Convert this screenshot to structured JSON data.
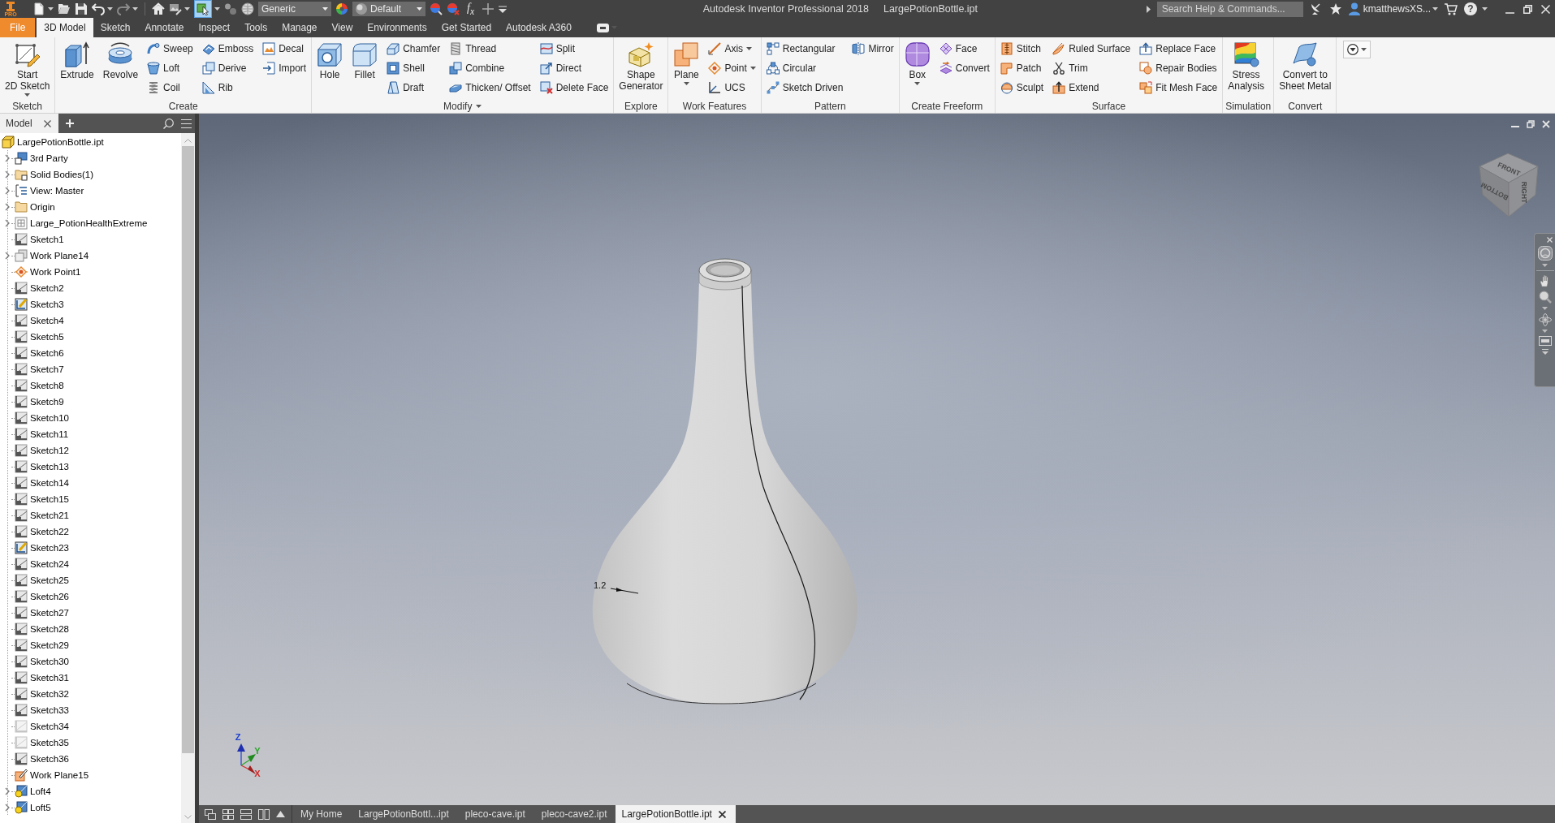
{
  "title_bar": {
    "badge": "PRO",
    "app_title": "Autodesk Inventor Professional 2018",
    "document": "LargePotionBottle.ipt",
    "search": {
      "placeholder": "Search Help & Commands..."
    },
    "user": "kmatthewsXS...",
    "help": "?"
  },
  "quick_access": {
    "material": "Generic",
    "appearance": "Default",
    "formula": "f$_{x}$"
  },
  "ribbon_tabs": [
    {
      "label": "File",
      "kind": "menu",
      "selected": false
    },
    {
      "label": "3D Model",
      "kind": "tab",
      "selected": true
    },
    {
      "label": "Sketch",
      "kind": "tab",
      "selected": false
    },
    {
      "label": "Annotate",
      "kind": "tab",
      "selected": false
    },
    {
      "label": "Inspect",
      "kind": "tab",
      "selected": false
    },
    {
      "label": "Tools",
      "kind": "tab",
      "selected": false
    },
    {
      "label": "Manage",
      "kind": "tab",
      "selected": false
    },
    {
      "label": "View",
      "kind": "tab",
      "selected": false
    },
    {
      "label": "Environments",
      "kind": "tab",
      "selected": false
    },
    {
      "label": "Get Started",
      "kind": "tab",
      "selected": false
    },
    {
      "label": "Autodesk A360",
      "kind": "tab",
      "selected": false
    }
  ],
  "ribbon_panels": [
    {
      "title": "Sketch",
      "menu": false,
      "buttons": [
        {
          "label": "Start\n2D Sketch",
          "kind": "large",
          "dropdown": true
        }
      ]
    },
    {
      "title": "Create",
      "menu": false,
      "buttons": [
        {
          "label": "Extrude",
          "kind": "large",
          "dropdown": false
        },
        {
          "label": "Revolve",
          "kind": "large",
          "dropdown": false
        },
        {
          "label": "Sweep",
          "kind": "small",
          "dropdown": false
        },
        {
          "label": "Loft",
          "kind": "small",
          "dropdown": false
        },
        {
          "label": "Coil",
          "kind": "small",
          "dropdown": false
        },
        {
          "label": "Emboss",
          "kind": "small",
          "dropdown": false
        },
        {
          "label": "Derive",
          "kind": "small",
          "dropdown": false
        },
        {
          "label": "Rib",
          "kind": "small",
          "dropdown": false
        },
        {
          "label": "Decal",
          "kind": "small",
          "dropdown": false
        },
        {
          "label": "Import",
          "kind": "small",
          "dropdown": false
        }
      ]
    },
    {
      "title": "Modify",
      "menu": true,
      "buttons": [
        {
          "label": "Hole",
          "kind": "large",
          "dropdown": false
        },
        {
          "label": "Fillet",
          "kind": "large",
          "dropdown": false
        },
        {
          "label": "Chamfer",
          "kind": "small",
          "dropdown": false
        },
        {
          "label": "Shell",
          "kind": "small",
          "dropdown": false
        },
        {
          "label": "Draft",
          "kind": "small",
          "dropdown": false
        },
        {
          "label": "Thread",
          "kind": "small",
          "dropdown": false
        },
        {
          "label": "Combine",
          "kind": "small",
          "dropdown": false
        },
        {
          "label": "Thicken/ Offset",
          "kind": "small",
          "dropdown": false
        },
        {
          "label": "Split",
          "kind": "small",
          "dropdown": false
        },
        {
          "label": "Direct",
          "kind": "small",
          "dropdown": false
        },
        {
          "label": "Delete Face",
          "kind": "small",
          "dropdown": false
        }
      ]
    },
    {
      "title": "Explore",
      "menu": false,
      "buttons": [
        {
          "label": "Shape\nGenerator",
          "kind": "large",
          "dropdown": false
        }
      ]
    },
    {
      "title": "Work Features",
      "menu": false,
      "buttons": [
        {
          "label": "Plane",
          "kind": "large",
          "dropdown": true
        },
        {
          "label": "Axis",
          "kind": "small",
          "dropdown": true
        },
        {
          "label": "Point",
          "kind": "small",
          "dropdown": true
        },
        {
          "label": "UCS",
          "kind": "small",
          "dropdown": false
        }
      ]
    },
    {
      "title": "Pattern",
      "menu": false,
      "buttons": [
        {
          "label": "Rectangular",
          "kind": "small",
          "dropdown": false
        },
        {
          "label": "Circular",
          "kind": "small",
          "dropdown": false
        },
        {
          "label": "Sketch Driven",
          "kind": "small",
          "dropdown": false
        },
        {
          "label": "Mirror",
          "kind": "small",
          "dropdown": false
        }
      ]
    },
    {
      "title": "Create Freeform",
      "menu": false,
      "buttons": [
        {
          "label": "Box",
          "kind": "large",
          "dropdown": true
        },
        {
          "label": "Face",
          "kind": "small",
          "dropdown": false
        },
        {
          "label": "Convert",
          "kind": "small",
          "dropdown": false
        }
      ]
    },
    {
      "title": "Surface",
      "menu": false,
      "buttons": [
        {
          "label": "Stitch",
          "kind": "small",
          "dropdown": false
        },
        {
          "label": "Patch",
          "kind": "small",
          "dropdown": false
        },
        {
          "label": "Sculpt",
          "kind": "small",
          "dropdown": false
        },
        {
          "label": "Ruled Surface",
          "kind": "small",
          "dropdown": false
        },
        {
          "label": "Trim",
          "kind": "small",
          "dropdown": false
        },
        {
          "label": "Extend",
          "kind": "small",
          "dropdown": false
        },
        {
          "label": "Replace Face",
          "kind": "small",
          "dropdown": false
        },
        {
          "label": "Repair Bodies",
          "kind": "small",
          "dropdown": false
        },
        {
          "label": "Fit Mesh Face",
          "kind": "small",
          "dropdown": false
        }
      ]
    },
    {
      "title": "Simulation",
      "menu": false,
      "buttons": [
        {
          "label": "Stress\nAnalysis",
          "kind": "large",
          "dropdown": false
        }
      ]
    },
    {
      "title": "Convert",
      "menu": false,
      "buttons": [
        {
          "label": "Convert to\nSheet Metal",
          "kind": "large",
          "dropdown": false
        }
      ]
    }
  ],
  "model_browser": {
    "tab": "Model",
    "tree": [
      {
        "label": "LargePotionBottle.ipt",
        "kind": "part",
        "collapsed": false,
        "children": [
          {
            "label": "3rd Party",
            "kind": "thirdparty",
            "collapsed": true
          },
          {
            "label": "Solid Bodies(1)",
            "kind": "bodies",
            "collapsed": true
          },
          {
            "label": "View: Master",
            "kind": "view",
            "collapsed": true
          },
          {
            "label": "Origin",
            "kind": "folder",
            "collapsed": true
          },
          {
            "label": "Large_PotionHealthExtreme",
            "kind": "derived",
            "collapsed": true
          },
          {
            "label": "Sketch1",
            "kind": "sketch",
            "collapsed": false
          },
          {
            "label": "Work Plane14",
            "kind": "workplane",
            "collapsed": true
          },
          {
            "label": "Work Point1",
            "kind": "workpoint",
            "collapsed": false
          },
          {
            "label": "Sketch2",
            "kind": "sketch",
            "collapsed": false
          },
          {
            "label": "Sketch3",
            "kind": "editsketch",
            "collapsed": false
          },
          {
            "label": "Sketch4",
            "kind": "sketch",
            "collapsed": false
          },
          {
            "label": "Sketch5",
            "kind": "sketch",
            "collapsed": false
          },
          {
            "label": "Sketch6",
            "kind": "sketch",
            "collapsed": false
          },
          {
            "label": "Sketch7",
            "kind": "sketch",
            "collapsed": false
          },
          {
            "label": "Sketch8",
            "kind": "sketch",
            "collapsed": false
          },
          {
            "label": "Sketch9",
            "kind": "sketch",
            "collapsed": false
          },
          {
            "label": "Sketch10",
            "kind": "sketch",
            "collapsed": false
          },
          {
            "label": "Sketch11",
            "kind": "sketch",
            "collapsed": false
          },
          {
            "label": "Sketch12",
            "kind": "sketch",
            "collapsed": false
          },
          {
            "label": "Sketch13",
            "kind": "sketch",
            "collapsed": false
          },
          {
            "label": "Sketch14",
            "kind": "sketch",
            "collapsed": false
          },
          {
            "label": "Sketch15",
            "kind": "sketch",
            "collapsed": false
          },
          {
            "label": "Sketch21",
            "kind": "sketch",
            "collapsed": false
          },
          {
            "label": "Sketch22",
            "kind": "sketch",
            "collapsed": false
          },
          {
            "label": "Sketch23",
            "kind": "editsketch",
            "collapsed": false
          },
          {
            "label": "Sketch24",
            "kind": "sketch",
            "collapsed": false
          },
          {
            "label": "Sketch25",
            "kind": "sketch",
            "collapsed": false
          },
          {
            "label": "Sketch26",
            "kind": "sketch",
            "collapsed": false
          },
          {
            "label": "Sketch27",
            "kind": "sketch",
            "collapsed": false
          },
          {
            "label": "Sketch28",
            "kind": "sketch",
            "collapsed": false
          },
          {
            "label": "Sketch29",
            "kind": "sketch",
            "collapsed": false
          },
          {
            "label": "Sketch30",
            "kind": "sketch",
            "collapsed": false
          },
          {
            "label": "Sketch31",
            "kind": "sketch",
            "collapsed": false
          },
          {
            "label": "Sketch32",
            "kind": "sketch",
            "collapsed": false
          },
          {
            "label": "Sketch33",
            "kind": "sketch",
            "collapsed": false
          },
          {
            "label": "Sketch34",
            "kind": "dimsketch",
            "collapsed": false
          },
          {
            "label": "Sketch35",
            "kind": "dimsketch",
            "collapsed": false
          },
          {
            "label": "Sketch36",
            "kind": "sketch",
            "collapsed": false
          },
          {
            "label": "Work Plane15",
            "kind": "editplane",
            "collapsed": false
          },
          {
            "label": "Loft4",
            "kind": "loft",
            "collapsed": true
          },
          {
            "label": "Loft5",
            "kind": "loft",
            "collapsed": true
          }
        ]
      }
    ]
  },
  "viewport": {
    "dimension": "1.2",
    "view_cube": [
      "FRONT",
      "RIGHT",
      "BOTTOM"
    ],
    "axes": [
      "Z",
      "Y",
      "X"
    ]
  },
  "document_tabs": [
    {
      "label": "My Home",
      "selected": false
    },
    {
      "label": "LargePotionBottl...ipt",
      "selected": false
    },
    {
      "label": "pleco-cave.ipt",
      "selected": false
    },
    {
      "label": "pleco-cave2.ipt",
      "selected": false
    },
    {
      "label": "LargePotionBottle.ipt",
      "selected": true
    }
  ]
}
